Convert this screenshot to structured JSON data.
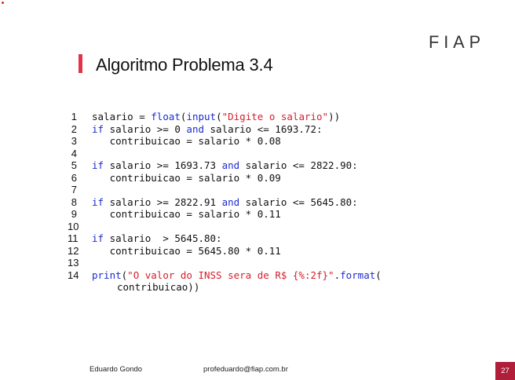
{
  "header": {
    "logo_text": "FIAP",
    "title": "Algoritmo Problema 3.4"
  },
  "code": {
    "lines": [
      {
        "n": "1",
        "segs": [
          [
            "p",
            "salario = "
          ],
          [
            "k",
            "float"
          ],
          [
            "p",
            "("
          ],
          [
            "k",
            "input"
          ],
          [
            "p",
            "("
          ],
          [
            "s",
            "\"Digite o salario\""
          ],
          [
            "p",
            "))"
          ]
        ]
      },
      {
        "n": "2",
        "segs": [
          [
            "k",
            "if"
          ],
          [
            "p",
            " salario >= 0 "
          ],
          [
            "k",
            "and"
          ],
          [
            "p",
            " salario <= 1693.72:"
          ]
        ]
      },
      {
        "n": "3",
        "segs": [
          [
            "p",
            "   contribuicao = salario * 0.08"
          ]
        ]
      },
      {
        "n": "4",
        "segs": []
      },
      {
        "n": "5",
        "segs": [
          [
            "k",
            "if"
          ],
          [
            "p",
            " salario >= 1693.73 "
          ],
          [
            "k",
            "and"
          ],
          [
            "p",
            " salario <= 2822.90:"
          ]
        ]
      },
      {
        "n": "6",
        "segs": [
          [
            "p",
            "   contribuicao = salario * 0.09"
          ]
        ]
      },
      {
        "n": "7",
        "segs": []
      },
      {
        "n": "8",
        "segs": [
          [
            "k",
            "if"
          ],
          [
            "p",
            " salario >= 2822.91 "
          ],
          [
            "k",
            "and"
          ],
          [
            "p",
            " salario <= 5645.80:"
          ]
        ]
      },
      {
        "n": "9",
        "segs": [
          [
            "p",
            "   contribuicao = salario * 0.11"
          ]
        ]
      },
      {
        "n": "10",
        "segs": []
      },
      {
        "n": "11",
        "segs": [
          [
            "k",
            "if"
          ],
          [
            "p",
            " salario  > 5645.80:"
          ]
        ]
      },
      {
        "n": "12",
        "segs": [
          [
            "p",
            "   contribuicao = 5645.80 * 0.11"
          ]
        ]
      },
      {
        "n": "13",
        "segs": []
      },
      {
        "n": "14",
        "segs": [
          [
            "k",
            "print"
          ],
          [
            "p",
            "("
          ],
          [
            "s",
            "\"O valor do INSS sera de R$ {%:2f}\""
          ],
          [
            "p",
            "."
          ],
          [
            "k",
            "format"
          ],
          [
            "p",
            "("
          ]
        ]
      }
    ],
    "continuation": "contribuicao))"
  },
  "footer": {
    "author": "Eduardo Gondo",
    "email": "profeduardo@fiap.com.br",
    "page_number": "27"
  },
  "colors": {
    "keyword": "#1d2bd1",
    "string": "#d61f2b",
    "accent": "#e0344a",
    "page_box": "#b01e3a"
  }
}
